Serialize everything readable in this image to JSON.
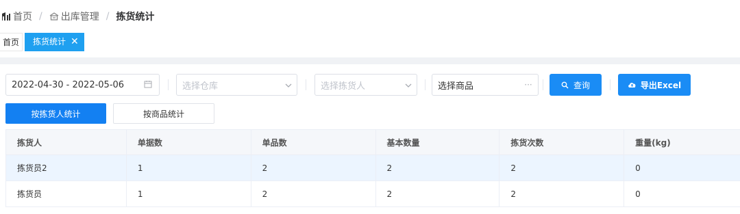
{
  "breadcrumb": {
    "home": "首页",
    "section": "出库管理",
    "current": "拣货统计",
    "separator": "/"
  },
  "tabs": {
    "home": "首页",
    "active": "拣货统计",
    "close_glyph": "✕"
  },
  "filters": {
    "date_range": "2022-04-30 - 2022-05-06",
    "warehouse_placeholder": "选择仓库",
    "picker_placeholder": "选择拣货人",
    "product_value": "选择商品",
    "product_suffix": "···",
    "query_label": "查询",
    "export_label": "导出Excel"
  },
  "stat_tabs": {
    "by_picker": "按拣货人统计",
    "by_product": "按商品统计"
  },
  "table": {
    "headers": [
      "拣货人",
      "单据数",
      "单品数",
      "基本数量",
      "拣货次数",
      "重量(kg)"
    ],
    "rows": [
      [
        "拣货员2",
        "1",
        "2",
        "2",
        "2",
        "0"
      ],
      [
        "拣货员",
        "1",
        "2",
        "2",
        "2",
        "0"
      ]
    ]
  },
  "colors": {
    "primary": "#1a8cf5",
    "tab_active": "#1fa0f0",
    "row_highlight": "#ecf5ff"
  }
}
